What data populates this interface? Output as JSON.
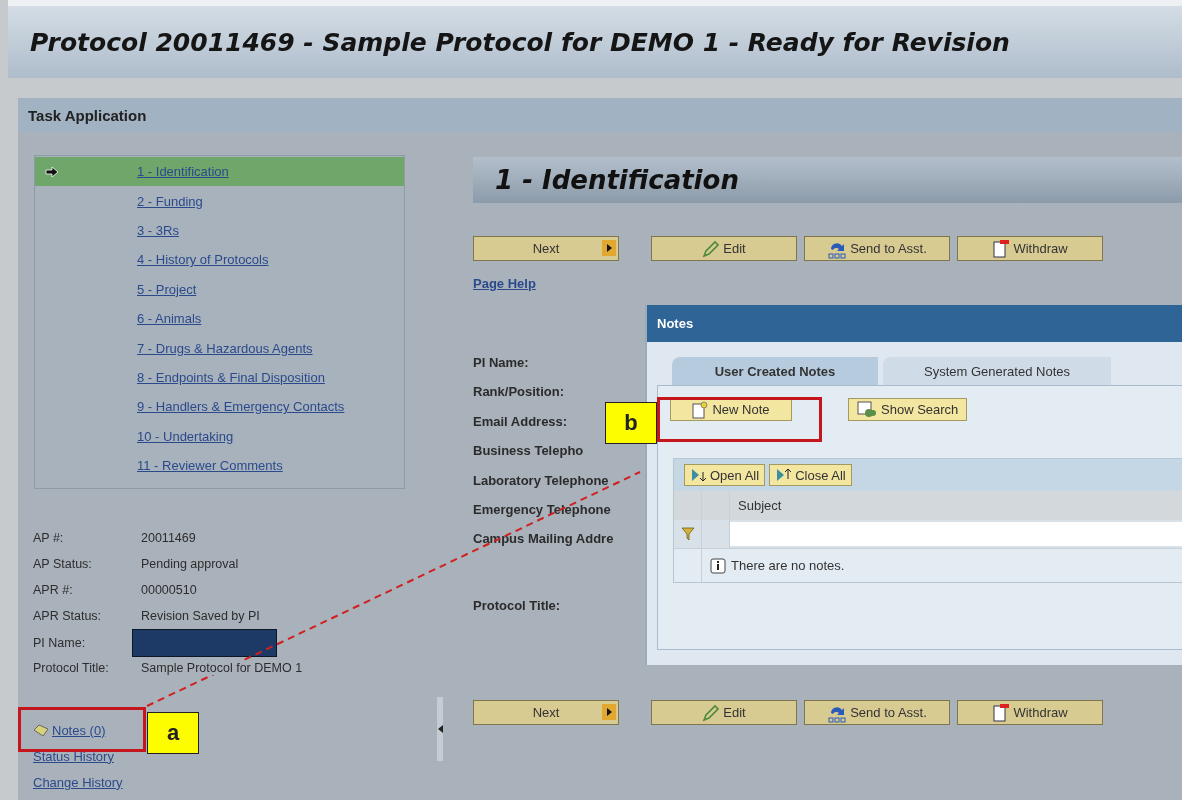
{
  "title": "Protocol 20011469 - Sample Protocol for DEMO 1 - Ready for Revision",
  "task_bar": {
    "title": "Task Application"
  },
  "sidebar": {
    "steps": [
      {
        "label": "1 - Identification",
        "selected": true
      },
      {
        "label": "2 - Funding",
        "selected": false
      },
      {
        "label": "3 - 3Rs",
        "selected": false
      },
      {
        "label": "4 - History of Protocols",
        "selected": false
      },
      {
        "label": "5 - Project",
        "selected": false
      },
      {
        "label": "6 - Animals",
        "selected": false
      },
      {
        "label": "7 - Drugs & Hazardous Agents",
        "selected": false
      },
      {
        "label": "8 - Endpoints & Final Disposition",
        "selected": false
      },
      {
        "label": "9 - Handlers & Emergency Contacts",
        "selected": false
      },
      {
        "label": "10 - Undertaking",
        "selected": false
      },
      {
        "label": "11 - Reviewer Comments",
        "selected": false
      }
    ],
    "info": [
      {
        "label": "AP #:",
        "value": "20011469",
        "redacted": false
      },
      {
        "label": "AP Status:",
        "value": "Pending approval",
        "redacted": false
      },
      {
        "label": "APR #:",
        "value": "00000510",
        "redacted": false
      },
      {
        "label": "APR Status:",
        "value": "Revision Saved by PI",
        "redacted": false
      },
      {
        "label": "PI Name:",
        "redacted": true
      },
      {
        "label": "Protocol Title:",
        "value": "Sample Protocol for DEMO 1",
        "redacted": false
      }
    ],
    "links": [
      {
        "label": "Notes (0)",
        "kind": "notes"
      },
      {
        "label": "Status History",
        "kind": "plain"
      },
      {
        "label": "Change History",
        "kind": "plain"
      }
    ]
  },
  "main": {
    "heading": "1 - Identification",
    "top_buttons": [
      "Next",
      "Edit",
      "Send to Asst.",
      "Withdraw"
    ],
    "page_help": "Page Help",
    "fields": [
      "PI Name:",
      "Rank/Position:",
      "Email Address:",
      "Business Telepho",
      "Laboratory Telephone",
      "Emergency Telephone",
      "Campus Mailing Addre"
    ],
    "protocol_title_label": "Protocol Title:",
    "bottom_buttons": [
      "Next",
      "Edit",
      "Send to Asst.",
      "Withdraw"
    ]
  },
  "notes_dialog": {
    "title": "Notes",
    "tabs": [
      {
        "label": "User Created Notes",
        "selected": true
      },
      {
        "label": "System Generated Notes",
        "selected": false
      }
    ],
    "buttons": [
      "New Note",
      "Show Search"
    ],
    "toolbar": [
      "Open All",
      "Close All"
    ],
    "columns": [
      "Subject"
    ],
    "empty_message": "There are no notes."
  },
  "callouts": [
    {
      "label": "a"
    },
    {
      "label": "b"
    }
  ]
}
